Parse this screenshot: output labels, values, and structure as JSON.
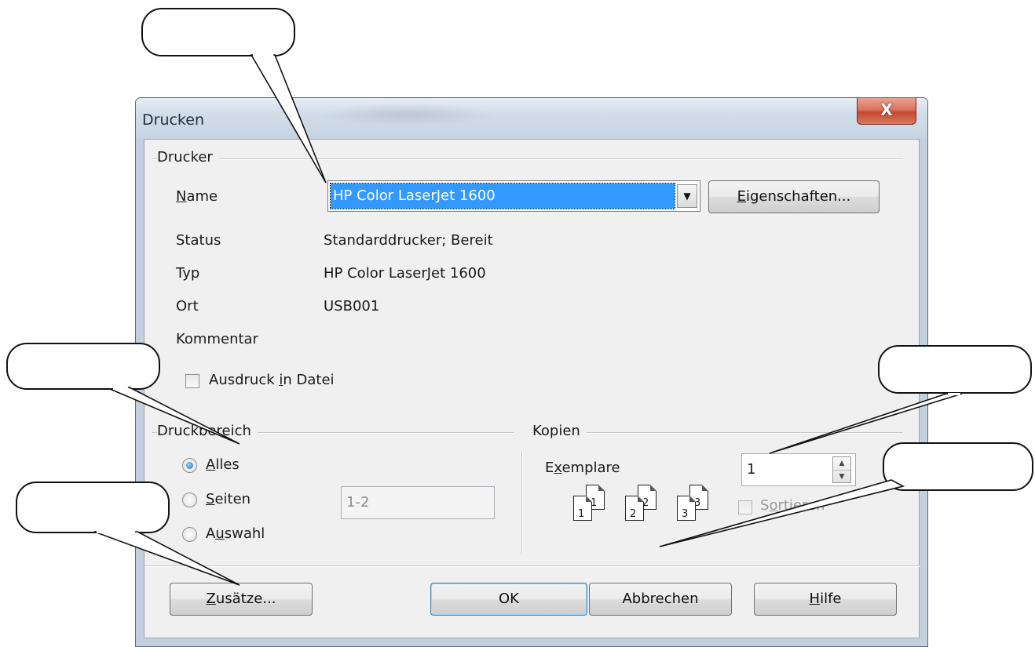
{
  "window": {
    "title": "Drucken",
    "close_label": "X"
  },
  "printer_group": {
    "label": "Drucker",
    "name_label": "Name",
    "name_value": "HP Color LaserJet 1600",
    "properties_button": "Eigenschaften...",
    "status_label": "Status",
    "status_value": "Standarddrucker; Bereit",
    "type_label": "Typ",
    "type_value": "HP Color LaserJet 1600",
    "location_label": "Ort",
    "location_value": "USB001",
    "comment_label": "Kommentar",
    "print_to_file_label": "Ausdruck in Datei",
    "print_to_file_checked": false
  },
  "range_group": {
    "label": "Druckbereich",
    "options": [
      {
        "label": "Alles",
        "selected": true
      },
      {
        "label": "Seiten",
        "selected": false
      },
      {
        "label": "Auswahl",
        "selected": false
      }
    ],
    "pages_value": "1-2"
  },
  "copies_group": {
    "label": "Kopien",
    "copies_label": "Exemplare",
    "copies_value": "1",
    "collate_label": "Sortieren",
    "collate_enabled": false,
    "collate_icon_pages": [
      {
        "front": "1",
        "back": "1"
      },
      {
        "front": "2",
        "back": "2"
      },
      {
        "front": "3",
        "back": "3"
      }
    ]
  },
  "buttons": {
    "options": "Zusätze...",
    "ok": "OK",
    "cancel": "Abbrechen",
    "help": "Hilfe"
  },
  "colors": {
    "selection": "#3399ff",
    "dialog_face": "#f0f0f0",
    "frame": "#c3d0dd",
    "close_button": "#c24a31"
  }
}
